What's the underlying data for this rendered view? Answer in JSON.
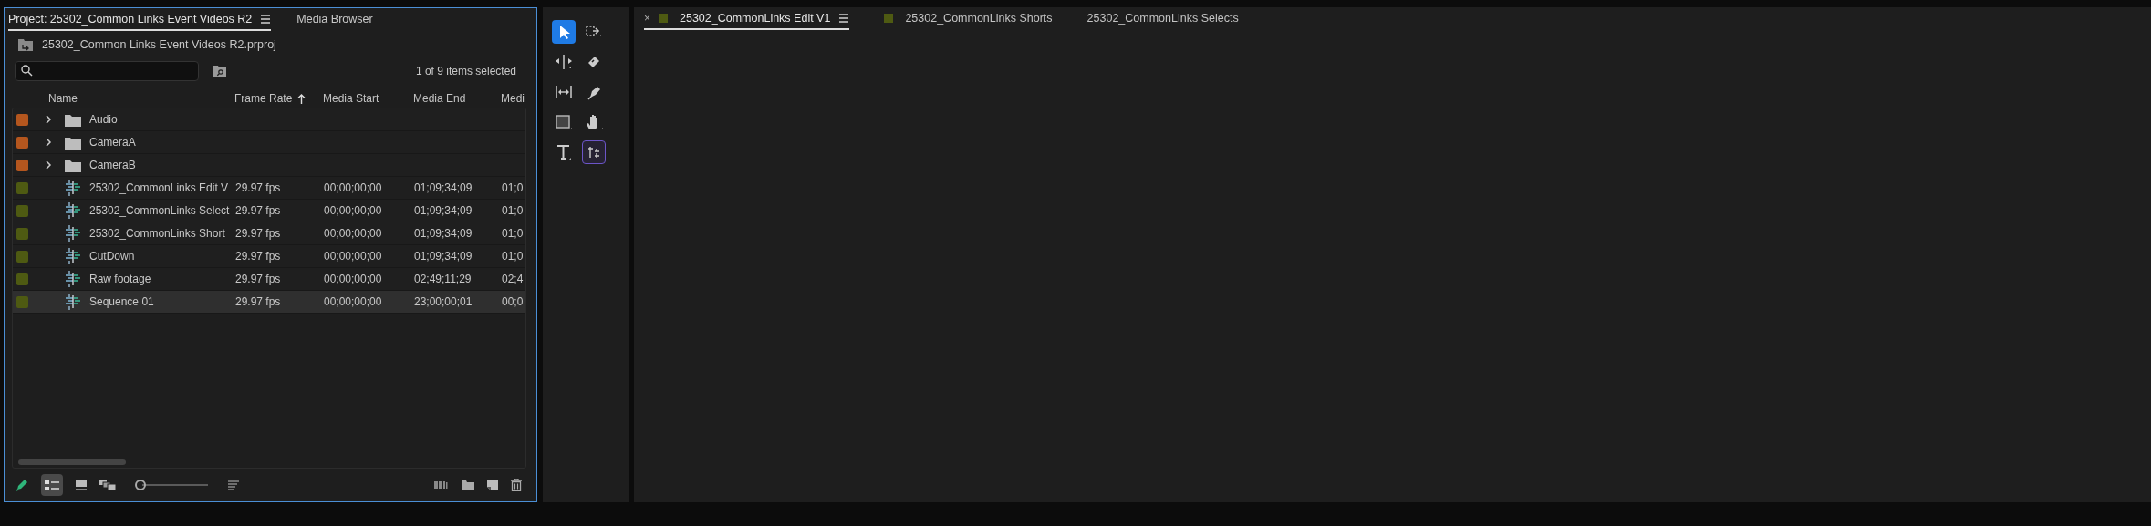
{
  "project_panel": {
    "tabs": [
      {
        "label": "Project: 25302_Common Links Event Videos R2",
        "selected": true
      },
      {
        "label": "Media Browser",
        "selected": false
      }
    ],
    "path": "25302_Common Links Event Videos R2.prproj",
    "selection_count": "1 of 9 items selected",
    "columns": [
      {
        "label": "Name",
        "sorted": false
      },
      {
        "label": "Frame Rate",
        "sorted": true
      },
      {
        "label": "Media Start",
        "sorted": false
      },
      {
        "label": "Media End",
        "sorted": false
      },
      {
        "label": "Medi",
        "sorted": false
      }
    ],
    "rows": [
      {
        "kind": "folder",
        "color": "#b4561e",
        "name": "Audio",
        "selected": false
      },
      {
        "kind": "folder",
        "color": "#b4561e",
        "name": "CameraA",
        "selected": false
      },
      {
        "kind": "folder",
        "color": "#b4561e",
        "name": "CameraB",
        "selected": false
      },
      {
        "kind": "sequence",
        "color": "#4e5a12",
        "name": "25302_CommonLinks Edit V",
        "frame_rate": "29.97 fps",
        "media_start": "00;00;00;00",
        "media_end": "01;09;34;09",
        "column_5": "01;0",
        "selected": false
      },
      {
        "kind": "sequence",
        "color": "#4e5a12",
        "name": "25302_CommonLinks Select",
        "frame_rate": "29.97 fps",
        "media_start": "00;00;00;00",
        "media_end": "01;09;34;09",
        "column_5": "01;0",
        "selected": false
      },
      {
        "kind": "sequence",
        "color": "#4e5a12",
        "name": "25302_CommonLinks Short",
        "frame_rate": "29.97 fps",
        "media_start": "00;00;00;00",
        "media_end": "01;09;34;09",
        "column_5": "01;0",
        "selected": false
      },
      {
        "kind": "sequence",
        "color": "#4e5a12",
        "name": "CutDown",
        "frame_rate": "29.97 fps",
        "media_start": "00;00;00;00",
        "media_end": "01;09;34;09",
        "column_5": "01;0",
        "selected": false
      },
      {
        "kind": "sequence",
        "color": "#4e5a12",
        "name": "Raw footage",
        "frame_rate": "29.97 fps",
        "media_start": "00;00;00;00",
        "media_end": "02;49;11;29",
        "column_5": "02;4",
        "selected": false
      },
      {
        "kind": "sequence",
        "color": "#4e5a12",
        "name": "Sequence 01",
        "frame_rate": "29.97 fps",
        "media_start": "00;00;00;00",
        "media_end": "23;00;00;01",
        "column_5": "00;0",
        "selected": true
      }
    ],
    "view": {
      "list_view_selected": true
    },
    "zoom_slider": {
      "level": 0
    }
  },
  "tools": [
    {
      "kind": "selection",
      "selected": true,
      "outlined": false
    },
    {
      "kind": "track_select",
      "selected": false,
      "outlined": false
    },
    {
      "kind": "ripple",
      "selected": false,
      "outlined": false
    },
    {
      "kind": "razor",
      "selected": false,
      "outlined": false
    },
    {
      "kind": "slip",
      "selected": false,
      "outlined": false
    },
    {
      "kind": "pen",
      "selected": false,
      "outlined": false
    },
    {
      "kind": "rectangle",
      "selected": false,
      "outlined": false
    },
    {
      "kind": "hand",
      "selected": false,
      "outlined": false
    },
    {
      "kind": "type",
      "selected": false,
      "outlined": false
    },
    {
      "kind": "remix",
      "selected": false,
      "outlined": true
    }
  ],
  "timeline_tabs": [
    {
      "label": "25302_CommonLinks Edit V1",
      "selected": true,
      "close": "×",
      "color": "#4e5a12"
    },
    {
      "label": "25302_CommonLinks Shorts",
      "selected": false,
      "color": "#4e5a12"
    },
    {
      "label": "25302_CommonLinks Selects",
      "selected": false
    }
  ]
}
